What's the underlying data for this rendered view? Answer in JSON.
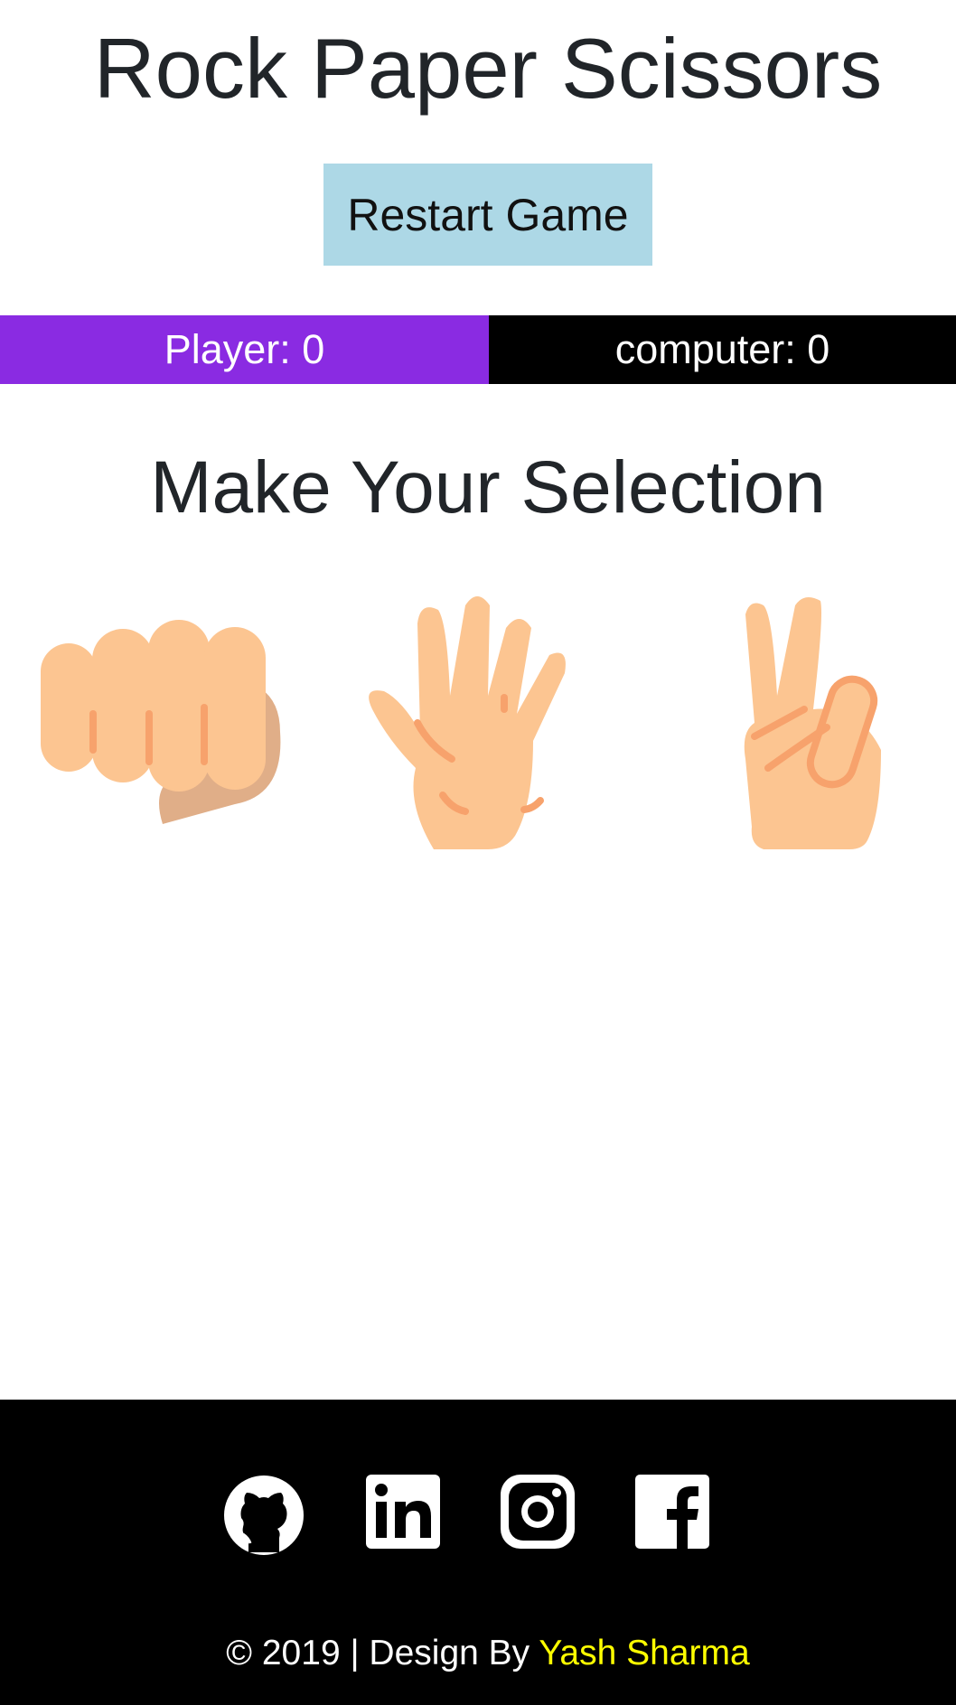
{
  "header": {
    "title": "Rock Paper Scissors",
    "restart_label": "Restart Game"
  },
  "scoreboard": {
    "player": "Player: 0",
    "computer": "computer: 0",
    "player_color": "#8a2be2",
    "computer_color": "#000000"
  },
  "selection": {
    "heading": "Make Your Selection",
    "choices": [
      {
        "name": "rock",
        "icon": "fist-icon"
      },
      {
        "name": "paper",
        "icon": "open-hand-icon"
      },
      {
        "name": "scissors",
        "icon": "victory-hand-icon"
      }
    ]
  },
  "footer": {
    "social_icons": [
      "github-icon",
      "linkedin-icon",
      "instagram-icon",
      "facebook-icon"
    ],
    "copyright_prefix": "© 2019 | Design By ",
    "author": "Yash Sharma",
    "author_color": "#ffff00"
  },
  "colors": {
    "restart_bg": "#add8e6",
    "skin": "#fcc591",
    "skin_shadow": "#e0ae88",
    "skin_line": "#f7a26c"
  }
}
